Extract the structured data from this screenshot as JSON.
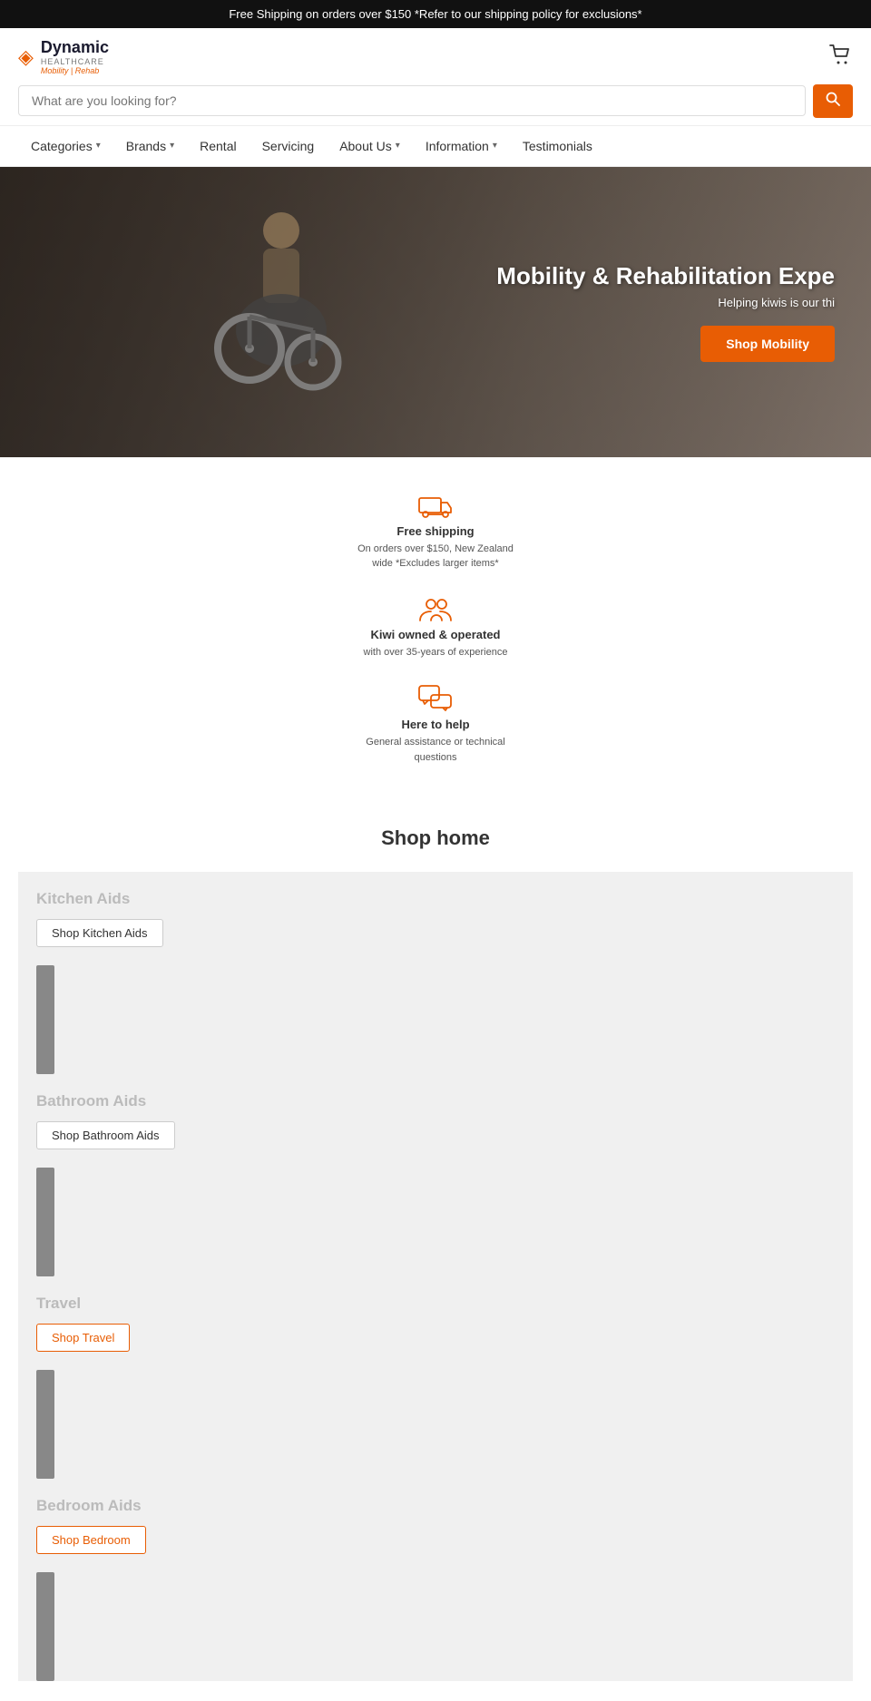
{
  "banner": {
    "text": "Free Shipping on orders over $150 *Refer to our shipping policy for exclusions*"
  },
  "header": {
    "logo_main": "Dynamic",
    "logo_sub": "HEALTHCARE",
    "logo_tagline": "Mobility | Rehab",
    "search_placeholder": "What are you looking for?",
    "cart_label": "Cart"
  },
  "nav": {
    "items": [
      {
        "label": "Categories",
        "has_dropdown": true
      },
      {
        "label": "Brands",
        "has_dropdown": true
      },
      {
        "label": "Rental",
        "has_dropdown": false
      },
      {
        "label": "Servicing",
        "has_dropdown": false
      },
      {
        "label": "About Us",
        "has_dropdown": true
      },
      {
        "label": "Information",
        "has_dropdown": true
      },
      {
        "label": "Testimonials",
        "has_dropdown": false
      }
    ]
  },
  "hero": {
    "title": "Mobility & Rehabilitation Expe",
    "subtitle": "Helping kiwis is our thi",
    "button_label": "Shop Mobility"
  },
  "features": [
    {
      "icon": "truck",
      "title": "Free shipping",
      "desc": "On orders over $150, New Zealand wide *Excludes larger items*"
    },
    {
      "icon": "users",
      "title": "Kiwi owned & operated",
      "desc": "with over 35-years of experience"
    },
    {
      "icon": "chat",
      "title": "Here to help",
      "desc": "General assistance or technical questions"
    }
  ],
  "shop_home": {
    "title": "Shop home",
    "categories": [
      {
        "name": "Kitchen Aids",
        "button": "Shop Kitchen Aids"
      },
      {
        "name": "Bathroom Aids",
        "button": "Shop Bathroom Aids"
      },
      {
        "name": "Travel",
        "button": "Shop Travel"
      },
      {
        "name": "Bedroom Aids",
        "button": "Shop Bedroom"
      }
    ]
  }
}
